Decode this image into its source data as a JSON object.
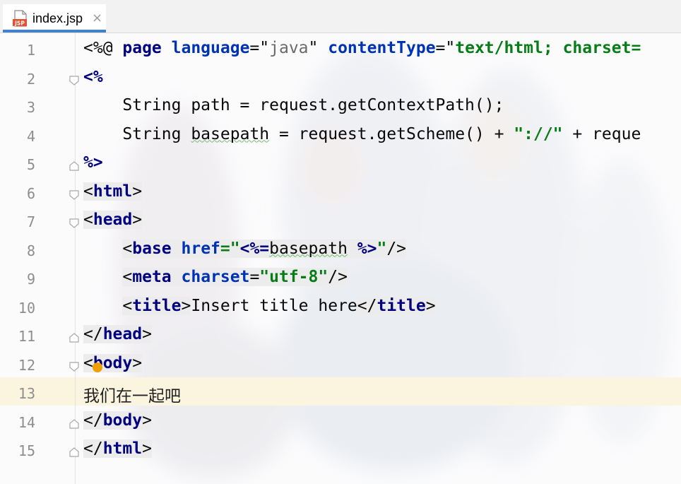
{
  "tab": {
    "label": "index.jsp",
    "icon_text": "JSP",
    "close_glyph": "×"
  },
  "editor": {
    "line_numbers": [
      "1",
      "2",
      "3",
      "4",
      "5",
      "6",
      "7",
      "8",
      "9",
      "10",
      "11",
      "12",
      "13",
      "14",
      "15"
    ],
    "current_line": 13,
    "lines": [
      [
        {
          "t": "<%@ ",
          "c": "plain"
        },
        {
          "t": "page ",
          "c": "kw"
        },
        {
          "t": "language",
          "c": "attr"
        },
        {
          "t": "=\"",
          "c": "plain"
        },
        {
          "t": "java",
          "c": "grey"
        },
        {
          "t": "\" ",
          "c": "plain"
        },
        {
          "t": "contentType",
          "c": "attr"
        },
        {
          "t": "=\"",
          "c": "plain"
        },
        {
          "t": "text/html; charset=",
          "c": "str"
        }
      ],
      [
        {
          "t": "<%",
          "c": "kw"
        }
      ],
      [
        {
          "t": "    String path = request.getContextPath();",
          "c": "plain"
        }
      ],
      [
        {
          "t": "    String ",
          "c": "plain"
        },
        {
          "t": "basepath",
          "c": "plain squig"
        },
        {
          "t": " = request.getScheme() + ",
          "c": "plain"
        },
        {
          "t": "\"://\"",
          "c": "str"
        },
        {
          "t": " + reque",
          "c": "plain"
        }
      ],
      [
        {
          "t": "%>",
          "c": "kw"
        }
      ],
      [
        {
          "t": "<",
          "c": "plain tagbg"
        },
        {
          "t": "html",
          "c": "kw tagbg"
        },
        {
          "t": ">",
          "c": "plain tagbg"
        }
      ],
      [
        {
          "t": "<",
          "c": "plain tagbg"
        },
        {
          "t": "head",
          "c": "kw tagbg"
        },
        {
          "t": ">",
          "c": "plain tagbg"
        }
      ],
      [
        {
          "t": "    ",
          "c": "plain"
        },
        {
          "t": "<",
          "c": "plain tagbg"
        },
        {
          "t": "base ",
          "c": "kw tagbg"
        },
        {
          "t": "href",
          "c": "attr tagbg"
        },
        {
          "t": "=\"",
          "c": "str tagbg"
        },
        {
          "t": "<%=",
          "c": "kw tagbg"
        },
        {
          "t": "basepath",
          "c": "plain squig tagbg"
        },
        {
          "t": " %>",
          "c": "kw tagbg"
        },
        {
          "t": "\"",
          "c": "str tagbg"
        },
        {
          "t": "/>",
          "c": "plain tagbg"
        }
      ],
      [
        {
          "t": "    ",
          "c": "plain"
        },
        {
          "t": "<",
          "c": "plain tagbg"
        },
        {
          "t": "meta ",
          "c": "kw tagbg"
        },
        {
          "t": "charset",
          "c": "attr tagbg"
        },
        {
          "t": "=",
          "c": "plain tagbg"
        },
        {
          "t": "\"utf-8\"",
          "c": "str tagbg"
        },
        {
          "t": "/>",
          "c": "plain tagbg"
        }
      ],
      [
        {
          "t": "    ",
          "c": "plain"
        },
        {
          "t": "<",
          "c": "plain tagbg"
        },
        {
          "t": "title",
          "c": "kw tagbg"
        },
        {
          "t": ">",
          "c": "plain tagbg"
        },
        {
          "t": "Insert title here",
          "c": "plain"
        },
        {
          "t": "</",
          "c": "plain tagbg"
        },
        {
          "t": "title",
          "c": "kw tagbg"
        },
        {
          "t": ">",
          "c": "plain tagbg"
        }
      ],
      [
        {
          "t": "</",
          "c": "plain tagbg"
        },
        {
          "t": "head",
          "c": "kw tagbg"
        },
        {
          "t": ">",
          "c": "plain tagbg"
        }
      ],
      [
        {
          "t": "<",
          "c": "plain tagbg"
        },
        {
          "t": "body",
          "c": "kw tagbg"
        },
        {
          "t": ">",
          "c": "plain tagbg"
        }
      ],
      [
        {
          "t": "我们在一起吧",
          "c": "cjk"
        }
      ],
      [
        {
          "t": "</",
          "c": "plain tagbg"
        },
        {
          "t": "body",
          "c": "kw tagbg"
        },
        {
          "t": ">",
          "c": "plain tagbg"
        }
      ],
      [
        {
          "t": "</",
          "c": "plain tagbg"
        },
        {
          "t": "html",
          "c": "kw tagbg"
        },
        {
          "t": ">",
          "c": "plain tagbg"
        }
      ]
    ],
    "fold_markers": [
      {
        "line": 2,
        "kind": "open"
      },
      {
        "line": 5,
        "kind": "close"
      },
      {
        "line": 6,
        "kind": "open"
      },
      {
        "line": 7,
        "kind": "open"
      },
      {
        "line": 11,
        "kind": "close"
      },
      {
        "line": 12,
        "kind": "open"
      },
      {
        "line": 14,
        "kind": "close"
      },
      {
        "line": 15,
        "kind": "close"
      }
    ],
    "intention_bulb_line": 12
  },
  "colors": {
    "keyword": "#000080",
    "attribute": "#0033b3",
    "string": "#067d17",
    "tab_underline": "#4083c9",
    "current_line": "#fbf5df"
  }
}
